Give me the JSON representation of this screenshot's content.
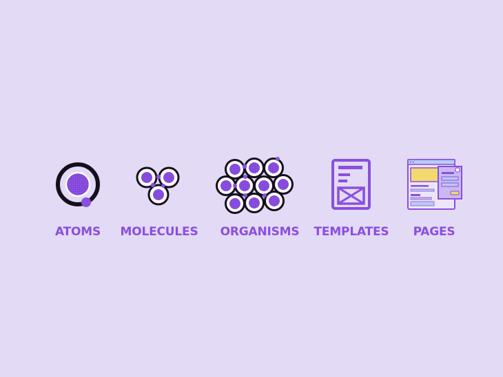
{
  "colors": {
    "background": "#e3daf5",
    "accent": "#8a4fde",
    "accent_dark": "#6f3bd0",
    "outline": "#150f1d",
    "label": "#8a4fde",
    "screen_blue": "#b7cdf4",
    "screen_yellow": "#f3da6e"
  },
  "stages": [
    {
      "label": "ATOMS",
      "icon": "atom-icon"
    },
    {
      "label": "MOLECULES",
      "icon": "molecule-icon"
    },
    {
      "label": "ORGANISMS",
      "icon": "organism-icon"
    },
    {
      "label": "TEMPLATES",
      "icon": "template-icon"
    },
    {
      "label": "PAGES",
      "icon": "page-icon"
    }
  ]
}
